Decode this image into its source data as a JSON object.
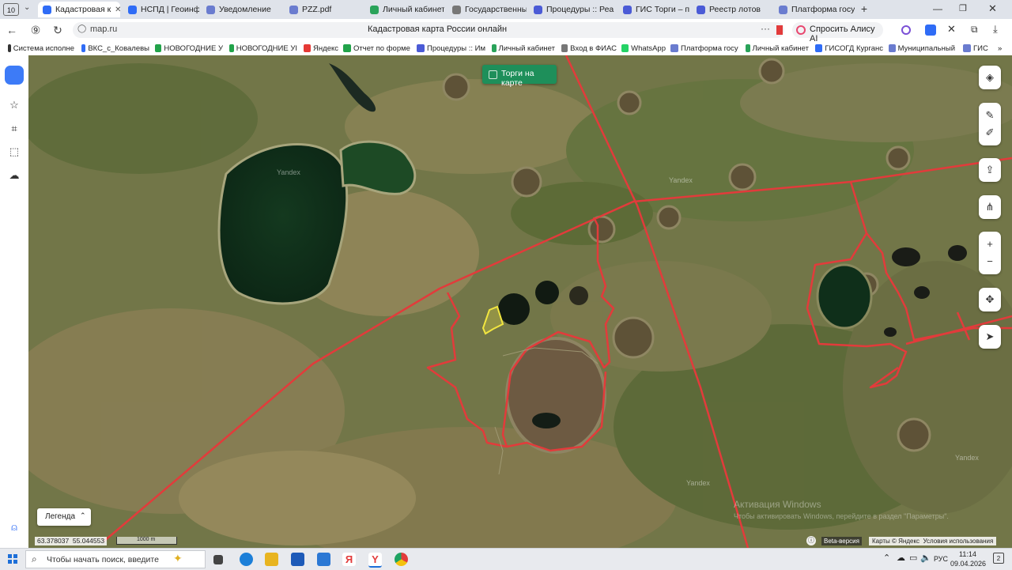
{
  "browser": {
    "tab_count": "10",
    "tabs": [
      {
        "label": "Кадастровая к",
        "active": true,
        "color": "#2f6cf6"
      },
      {
        "label": "НСПД | Геоинфор",
        "color": "#2f6cf6"
      },
      {
        "label": "Уведомление",
        "color": "#6a7ccf"
      },
      {
        "label": "PZZ.pdf",
        "color": "#6a7ccf"
      },
      {
        "label": "Личный кабинет",
        "color": "#2aa35a"
      },
      {
        "label": "Государственный",
        "color": "#777777"
      },
      {
        "label": "Процедуры :: Реа",
        "color": "#4b5bd6"
      },
      {
        "label": "ГИС Торги – прод",
        "color": "#4b5bd6"
      },
      {
        "label": "Реестр лотов",
        "color": "#4b5bd6"
      },
      {
        "label": "Платформа госуд",
        "color": "#6a7ccf"
      }
    ],
    "address": "map.ru",
    "page_title": "Кадастровая карта России онлайн",
    "alice_label": "Спросить Алису AI",
    "bookmarks": [
      {
        "label": "Система исполне",
        "color": "#333333"
      },
      {
        "label": "ВКС_с_Ковалевы",
        "color": "#2f6cf6"
      },
      {
        "label": "НОВОГОДНИЕ У",
        "color": "#22a34a"
      },
      {
        "label": "НОВОГОДНИЕ УІ",
        "color": "#22a34a"
      },
      {
        "label": "Яндекс",
        "color": "#e53935"
      },
      {
        "label": "Отчет по форме",
        "color": "#22a34a"
      },
      {
        "label": "Процедуры :: Им",
        "color": "#4b5bd6"
      },
      {
        "label": "Личный кабинет",
        "color": "#2aa35a"
      },
      {
        "label": "Вход в ФИАС",
        "color": "#777777"
      },
      {
        "label": "WhatsApp",
        "color": "#25d366"
      },
      {
        "label": "Платформа госу",
        "color": "#6a7ccf"
      },
      {
        "label": "Личный кабинет",
        "color": "#2aa35a"
      },
      {
        "label": "ГИСОГД Курганс",
        "color": "#2f6cf6"
      },
      {
        "label": "Муниципальный",
        "color": "#6a7ccf"
      },
      {
        "label": "ГИС",
        "color": "#6a7ccf"
      }
    ]
  },
  "map": {
    "auction_toggle_label": "Торги на карте",
    "watermarks": [
      "Yandex",
      "Yandex",
      "Yandex",
      "Yandex"
    ],
    "legend_label": "Легенда",
    "coordinates": "63.378037  55.044553",
    "scale_label": "1000 m",
    "beta_label": "Beta-версия",
    "copyright": "Карты © Яндекс  Условия использования",
    "activation_title": "Активация Windows",
    "activation_sub": "Чтобы активировать Windows, перейдите в раздел \"Параметры\"."
  },
  "taskbar": {
    "search_placeholder": "Чтобы начать поиск, введите",
    "lang": "РУС",
    "time": "11:14",
    "date": "09.04.2026",
    "notifications": "2"
  },
  "colors": {
    "accent": "#1e8f5a",
    "boundary": "#e23b3b",
    "selection": "#f2e640"
  }
}
